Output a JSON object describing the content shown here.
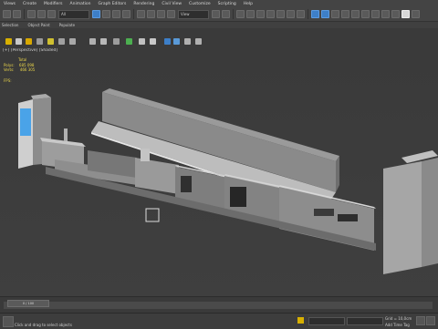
{
  "menu": [
    "Views",
    "Create",
    "Modifiers",
    "Animation",
    "Graph Editors",
    "Rendering",
    "Civil View",
    "Customize",
    "Scripting",
    "Help"
  ],
  "toolbar": {
    "selection_dropdown": "All",
    "view_dropdown": "View"
  },
  "ribbon_labels": [
    "Selection",
    "Object Paint",
    "Populate"
  ],
  "viewport": {
    "label": "[+] [Perspective] [Shaded]",
    "stats_header": "Total",
    "polys_label": "Polys:",
    "polys_value": "685 098",
    "verts_label": "Verts:",
    "verts_value": "466 305",
    "fps_label": "FPS:"
  },
  "timeline": {
    "frame": "0 / 100"
  },
  "status": {
    "message": "Click and drag to select objects",
    "grid": "Grid = 10,0cm",
    "add_time_tag": "Add Time Tag"
  },
  "colors": {
    "bg": "#3c3c3c",
    "accent": "#3d7fc8",
    "stats": "#e8d34a"
  }
}
